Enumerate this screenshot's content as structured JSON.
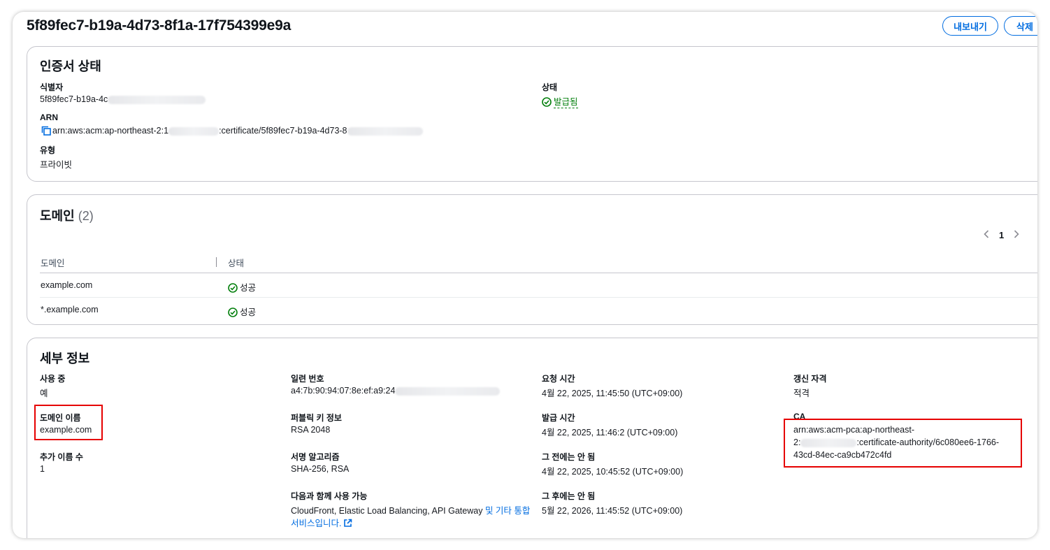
{
  "header": {
    "title": "5f89fec7-b19a-4d73-8f1a-17f754399e9a",
    "export_label": "내보내기",
    "delete_label": "삭제"
  },
  "cert_status": {
    "title": "인증서 상태",
    "identifier_label": "식별자",
    "identifier_value": "5f89fec7-b19a-4c",
    "status_label": "상태",
    "status_value": "발급됨",
    "arn_label": "ARN",
    "arn_prefix": "arn:aws:acm:ap-northeast-2:1",
    "arn_mid": ":certificate/5f89fec7-b19a-4d73-8",
    "type_label": "유형",
    "type_value": "프라이빗"
  },
  "domains": {
    "title": "도메인",
    "count": "(2)",
    "page": "1",
    "columns": [
      "도메인",
      "상태"
    ],
    "rows": [
      {
        "domain": "example.com",
        "status": "성공"
      },
      {
        "domain": "*.example.com",
        "status": "성공"
      }
    ]
  },
  "details": {
    "title": "세부 정보",
    "in_use_label": "사용 중",
    "in_use_value": "예",
    "domain_name_label": "도메인 이름",
    "domain_name_value": "example.com",
    "additional_names_label": "추가 이름 수",
    "additional_names_value": "1",
    "serial_label": "일련 번호",
    "serial_value": "a4:7b:90:94:07:8e:ef:a9:24",
    "pubkey_label": "퍼블릭 키 정보",
    "pubkey_value": "RSA 2048",
    "sigalg_label": "서명 알고리즘",
    "sigalg_value": "SHA-256, RSA",
    "eligible_label": "다음과 함께 사용 가능",
    "eligible_value": "CloudFront, Elastic Load Balancing, API Gateway",
    "eligible_link_1": "및 기타 통합",
    "eligible_link_2": "서비스입니다.",
    "requested_label": "요청 시간",
    "requested_value": "4월 22, 2025, 11:45:50 (UTC+09:00)",
    "issued_label": "발급 시간",
    "issued_value": "4월 22, 2025, 11:46:2 (UTC+09:00)",
    "not_before_label": "그 전에는 안 됨",
    "not_before_value": "4월 22, 2025, 10:45:52 (UTC+09:00)",
    "not_after_label": "그 후에는 안 됨",
    "not_after_value": "5월 22, 2026, 11:45:52 (UTC+09:00)",
    "renewal_label": "갱신 자격",
    "renewal_value": "적격",
    "ca_label": "CA",
    "ca_line1": "arn:aws:acm-pca:ap-northeast-",
    "ca_line2_prefix": "2:",
    "ca_line2_suffix": ":certificate-authority/6c080ee6-1766-",
    "ca_line3": "43cd-84ec-ca9cb472c4fd"
  },
  "colors": {
    "accent": "#006ce0",
    "success": "#037f0c",
    "highlight": "#e60000"
  }
}
